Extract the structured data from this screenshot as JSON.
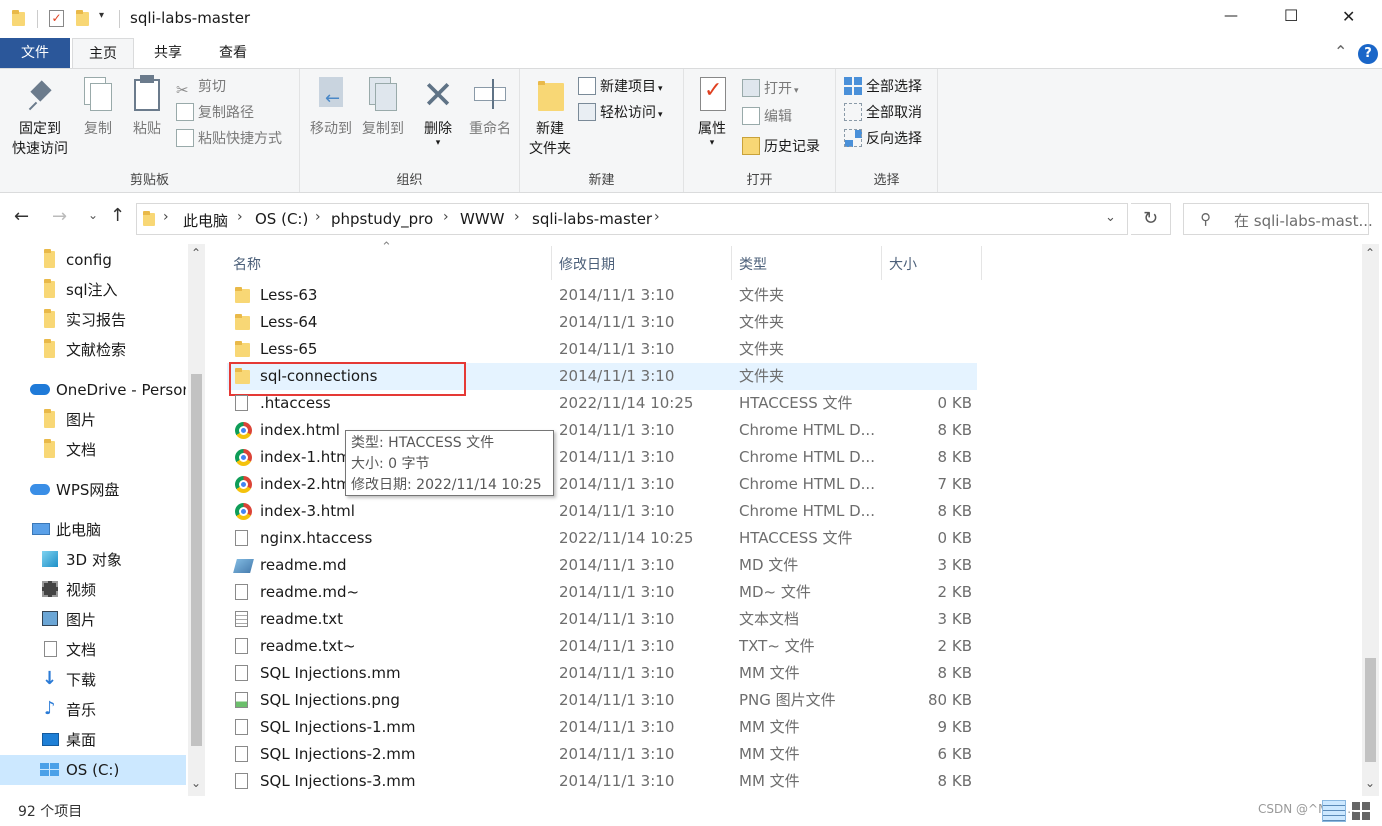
{
  "window": {
    "title": "sqli-labs-master",
    "controls": {
      "minimize": "—",
      "maximize": "☐",
      "close": "✕"
    }
  },
  "menu": {
    "tabs": [
      {
        "label": "文件"
      },
      {
        "label": "主页"
      },
      {
        "label": "共享"
      },
      {
        "label": "查看"
      }
    ],
    "collapse": "⌃",
    "help": "?"
  },
  "ribbon": {
    "clipboard": {
      "label": "剪贴板",
      "pin_line1": "固定到",
      "pin_line2": "快速访问",
      "copy": "复制",
      "paste": "粘贴",
      "cut": "剪切",
      "copy_path": "复制路径",
      "paste_shortcut": "粘贴快捷方式"
    },
    "organize": {
      "label": "组织",
      "move_to": "移动到",
      "copy_to": "复制到",
      "delete": "删除",
      "rename": "重命名"
    },
    "new": {
      "label": "新建",
      "new_folder_line1": "新建",
      "new_folder_line2": "文件夹",
      "new_item": "新建项目",
      "easy_access": "轻松访问"
    },
    "open": {
      "label": "打开",
      "properties": "属性",
      "open": "打开",
      "edit": "编辑",
      "history": "历史记录"
    },
    "select": {
      "label": "选择",
      "select_all": "全部选择",
      "select_none": "全部取消",
      "invert": "反向选择"
    }
  },
  "address": {
    "breadcrumbs": [
      "此电脑",
      "OS (C:)",
      "phpstudy_pro",
      "WWW",
      "sqli-labs-master"
    ],
    "search_placeholder": "在 sqli-labs-mast..."
  },
  "nav": {
    "items": [
      {
        "label": "config",
        "icon": "folder-icon"
      },
      {
        "label": "sql注入",
        "icon": "folder-icon"
      },
      {
        "label": "实习报告",
        "icon": "folder-icon"
      },
      {
        "label": "文献检索",
        "icon": "folder-icon"
      },
      {
        "label": "OneDrive - Personal",
        "icon": "cloud-icon"
      },
      {
        "label": "图片",
        "icon": "folder-icon"
      },
      {
        "label": "文档",
        "icon": "folder-icon"
      },
      {
        "label": "WPS网盘",
        "icon": "cloud-icon"
      },
      {
        "label": "此电脑",
        "icon": "computer-icon"
      },
      {
        "label": "3D 对象",
        "icon": "cube-icon"
      },
      {
        "label": "视频",
        "icon": "video-icon"
      },
      {
        "label": "图片",
        "icon": "pictures-icon"
      },
      {
        "label": "文档",
        "icon": "documents-icon"
      },
      {
        "label": "下载",
        "icon": "download-icon"
      },
      {
        "label": "音乐",
        "icon": "music-icon"
      },
      {
        "label": "桌面",
        "icon": "desktop-icon"
      },
      {
        "label": "OS (C:)",
        "icon": "drive-icon"
      }
    ]
  },
  "files": {
    "columns": {
      "name": "名称",
      "date": "修改日期",
      "type": "类型",
      "size": "大小"
    },
    "rows": [
      {
        "name": "Less-63",
        "date": "2014/11/1 3:10",
        "type": "文件夹",
        "size": "",
        "icon": "folder-icon"
      },
      {
        "name": "Less-64",
        "date": "2014/11/1 3:10",
        "type": "文件夹",
        "size": "",
        "icon": "folder-icon"
      },
      {
        "name": "Less-65",
        "date": "2014/11/1 3:10",
        "type": "文件夹",
        "size": "",
        "icon": "folder-icon"
      },
      {
        "name": "sql-connections",
        "date": "2014/11/1 3:10",
        "type": "文件夹",
        "size": "",
        "icon": "folder-icon"
      },
      {
        "name": ".htaccess",
        "date": "2022/11/14 10:25",
        "type": "HTACCESS 文件",
        "size": "0 KB",
        "icon": "file-icon"
      },
      {
        "name": "index.html",
        "date": "2014/11/1 3:10",
        "type": "Chrome HTML D...",
        "size": "8 KB",
        "icon": "chrome-icon"
      },
      {
        "name": "index-1.html",
        "date": "2014/11/1 3:10",
        "type": "Chrome HTML D...",
        "size": "8 KB",
        "icon": "chrome-icon"
      },
      {
        "name": "index-2.html",
        "date": "2014/11/1 3:10",
        "type": "Chrome HTML D...",
        "size": "7 KB",
        "icon": "chrome-icon"
      },
      {
        "name": "index-3.html",
        "date": "2014/11/1 3:10",
        "type": "Chrome HTML D...",
        "size": "8 KB",
        "icon": "chrome-icon"
      },
      {
        "name": "nginx.htaccess",
        "date": "2022/11/14 10:25",
        "type": "HTACCESS 文件",
        "size": "0 KB",
        "icon": "file-icon"
      },
      {
        "name": "readme.md",
        "date": "2014/11/1 3:10",
        "type": "MD 文件",
        "size": "3 KB",
        "icon": "md-icon"
      },
      {
        "name": "readme.md~",
        "date": "2014/11/1 3:10",
        "type": "MD~ 文件",
        "size": "2 KB",
        "icon": "file-icon"
      },
      {
        "name": "readme.txt",
        "date": "2014/11/1 3:10",
        "type": "文本文档",
        "size": "3 KB",
        "icon": "text-file-icon"
      },
      {
        "name": "readme.txt~",
        "date": "2014/11/1 3:10",
        "type": "TXT~ 文件",
        "size": "2 KB",
        "icon": "file-icon"
      },
      {
        "name": "SQL Injections.mm",
        "date": "2014/11/1 3:10",
        "type": "MM 文件",
        "size": "8 KB",
        "icon": "file-icon"
      },
      {
        "name": "SQL Injections.png",
        "date": "2014/11/1 3:10",
        "type": "PNG 图片文件",
        "size": "80 KB",
        "icon": "image-file-icon"
      },
      {
        "name": "SQL Injections-1.mm",
        "date": "2014/11/1 3:10",
        "type": "MM 文件",
        "size": "9 KB",
        "icon": "file-icon"
      },
      {
        "name": "SQL Injections-2.mm",
        "date": "2014/11/1 3:10",
        "type": "MM 文件",
        "size": "6 KB",
        "icon": "file-icon"
      },
      {
        "name": "SQL Injections-3.mm",
        "date": "2014/11/1 3:10",
        "type": "MM 文件",
        "size": "8 KB",
        "icon": "file-icon"
      }
    ]
  },
  "tooltip": {
    "type_line": "类型: HTACCESS 文件",
    "size_line": "大小: 0 字节",
    "date_line": "修改日期: 2022/11/14 10:25"
  },
  "status": {
    "count": "92 个项目",
    "watermark": "CSDN @^Mon..."
  },
  "colors": {
    "file_tab": "#2b579a",
    "selection": "#e5f3ff",
    "highlight_box": "#e53935",
    "folder": "#f8d775"
  }
}
